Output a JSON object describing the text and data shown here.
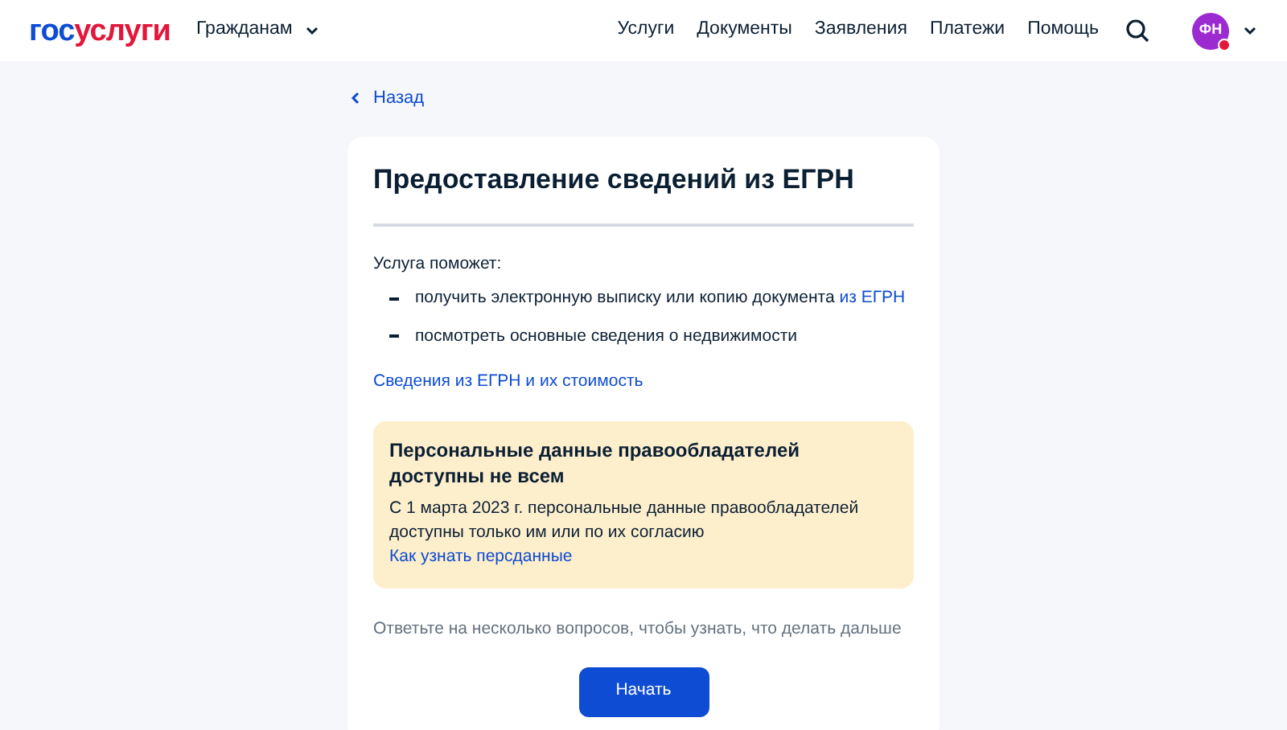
{
  "header": {
    "logo": {
      "prefix": "гос",
      "suffix": "услуги"
    },
    "audience": "Гражданам",
    "nav": [
      "Услуги",
      "Документы",
      "Заявления",
      "Платежи",
      "Помощь"
    ],
    "avatar": {
      "initials": "ФН",
      "notification": true
    }
  },
  "back": "Назад",
  "card": {
    "title": "Предоставление сведений из ЕГРН",
    "intro": "Услуга поможет:",
    "bullets": [
      {
        "text": "получить электронную выписку или копию документа",
        "link": "из ЕГРН"
      },
      {
        "text": "посмотреть основные сведения о недвижимости"
      }
    ],
    "info_link": "Сведения из ЕГРН и их стоимость",
    "notice": {
      "title": "Персональные данные правообладателей доступны не всем",
      "text": "С 1 марта 2023 г. персональные данные правообладателей доступны только им или по их согласию",
      "link": "Как узнать персданные"
    },
    "hint": "Ответьте на несколько вопросов, чтобы узнать, что делать дальше",
    "button": "Начать"
  }
}
